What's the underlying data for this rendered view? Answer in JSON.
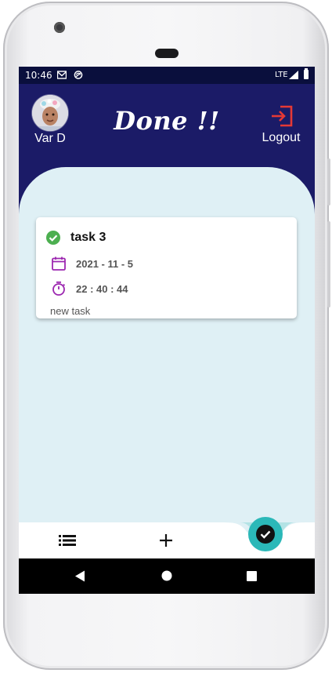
{
  "status_bar": {
    "time": "10:46",
    "network": "LTE"
  },
  "header": {
    "user_name": "Var D",
    "title": "Done !!",
    "logout_label": "Logout"
  },
  "tasks": [
    {
      "title": "task 3",
      "date": "2021 - 11 - 5",
      "time": "22 : 40 : 44",
      "description": "new task"
    }
  ],
  "icons": {
    "status": [
      "gmail-icon",
      "sync-icon",
      "signal-icon",
      "battery-icon"
    ],
    "header": [
      "avatar",
      "logout-icon"
    ],
    "card": [
      "check-circle-icon",
      "calendar-icon",
      "stopwatch-icon"
    ],
    "bottom_nav": [
      "list-icon",
      "plus-icon",
      "check-circle-icon"
    ],
    "system_nav": [
      "back-icon",
      "home-icon",
      "recents-icon"
    ]
  },
  "colors": {
    "header_bg": "#1b1b67",
    "content_bg": "#dff0f5",
    "accent_teal": "#2bb8b8",
    "done_green": "#4caf50",
    "meta_purple": "#9c27b0",
    "logout_red": "#e53935"
  }
}
